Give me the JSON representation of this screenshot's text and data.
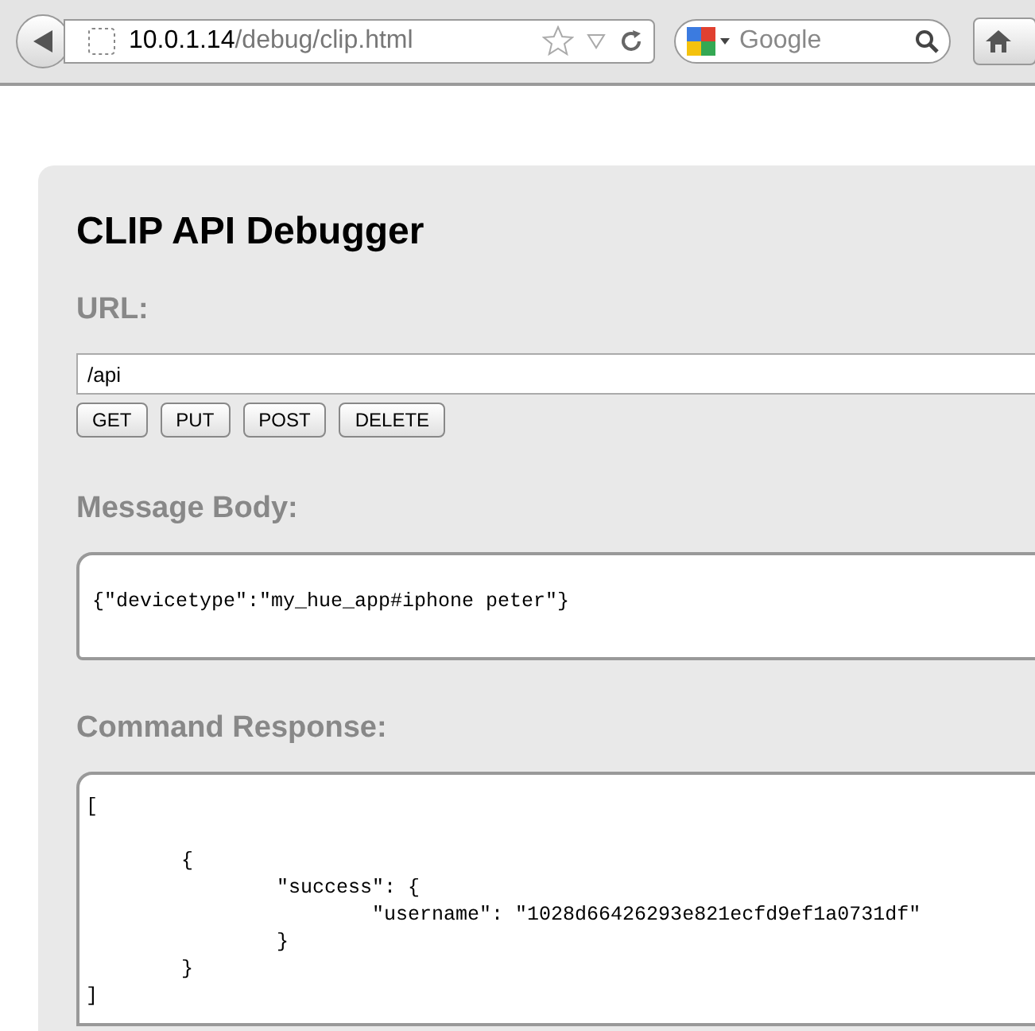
{
  "browser": {
    "url_host": "10.0.1.14",
    "url_path": "/debug/clip.html",
    "search_placeholder": "Google"
  },
  "page": {
    "title": "CLIP API Debugger",
    "url_label": "URL:",
    "url_value": "/api",
    "methods": [
      "GET",
      "PUT",
      "POST",
      "DELETE"
    ],
    "body_label": "Message Body:",
    "body_value": "{\"devicetype\":\"my_hue_app#iphone peter\"}",
    "response_label": "Command Response:",
    "response_value": "[\n\n\t{\n\t\t\"success\": {\n\t\t\t\"username\": \"1028d66426293e821ecfd9ef1a0731df\"\n\t\t}\n\t}\n]"
  }
}
